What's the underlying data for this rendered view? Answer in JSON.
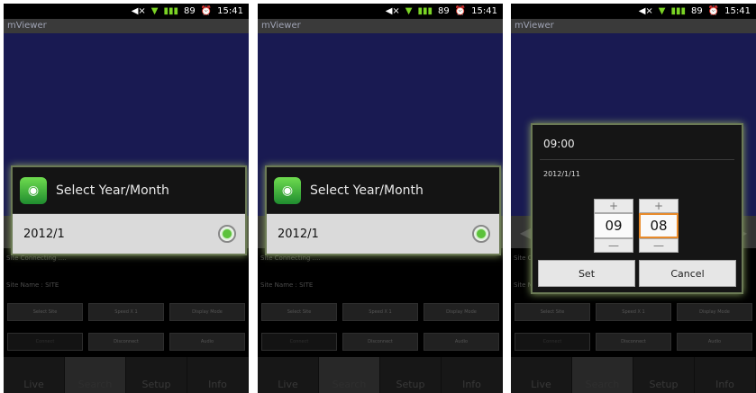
{
  "status": {
    "time": "15:41",
    "battery": "89"
  },
  "app": {
    "title": "mViewer"
  },
  "status_lines": {
    "connecting": "Site Connecting ....",
    "site_name": "Site Name : SITE"
  },
  "buttons": {
    "select_site": "Select Site",
    "speed": "Speed X 1",
    "display_mode": "Display Mode",
    "connect": "Connect",
    "disconnect": "Disconnect",
    "audio": "Audio"
  },
  "tabs": [
    "Live",
    "Search",
    "Setup",
    "Info"
  ],
  "year_month_dialog": {
    "title": "Select Year/Month",
    "option": "2012/1"
  },
  "time_dialog": {
    "time": "09:00",
    "date": "2012/1/11",
    "hour": "09",
    "minute": "08",
    "plus": "+",
    "minus": "—",
    "set_label": "Set",
    "cancel_label": "Cancel"
  }
}
